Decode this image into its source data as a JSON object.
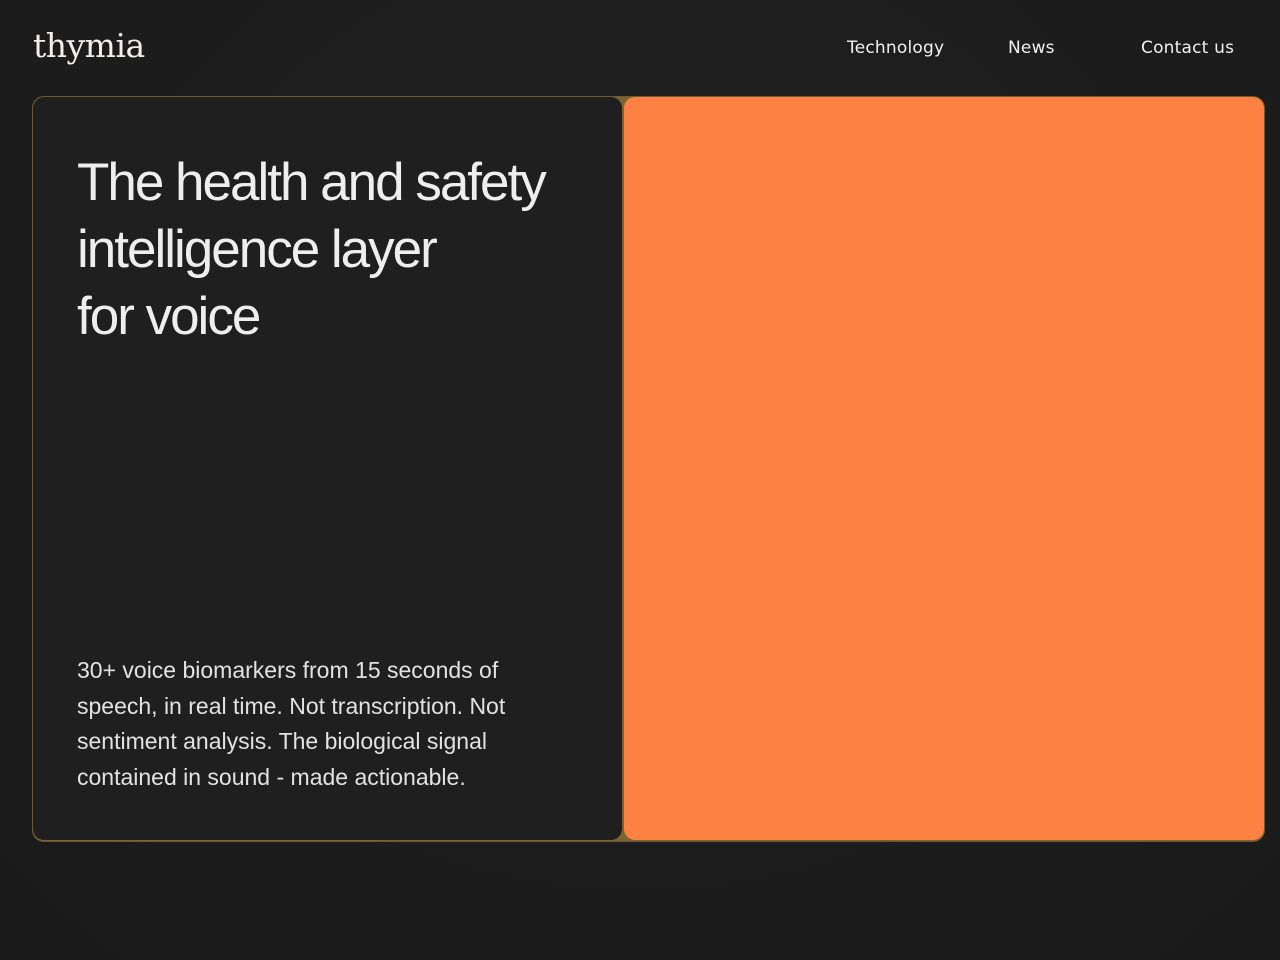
{
  "header": {
    "logo": "thymia",
    "nav": {
      "technology": "Technology",
      "news": "News",
      "contact": "Contact us"
    }
  },
  "hero": {
    "headline_lines": [
      "The health and safety",
      "intelligence layer",
      "for voice"
    ],
    "description_lines": [
      "30+ voice biomarkers from 15 seconds of",
      "speech, in real time. Not transcription. Not",
      "sentiment analysis. The biological signal",
      "contained in sound - made actionable."
    ]
  },
  "colors": {
    "background": "#1e1e1e",
    "panel": "#1f1f1f",
    "accent_orange": "#fd8142",
    "border_gold": "#6e5a2a"
  }
}
